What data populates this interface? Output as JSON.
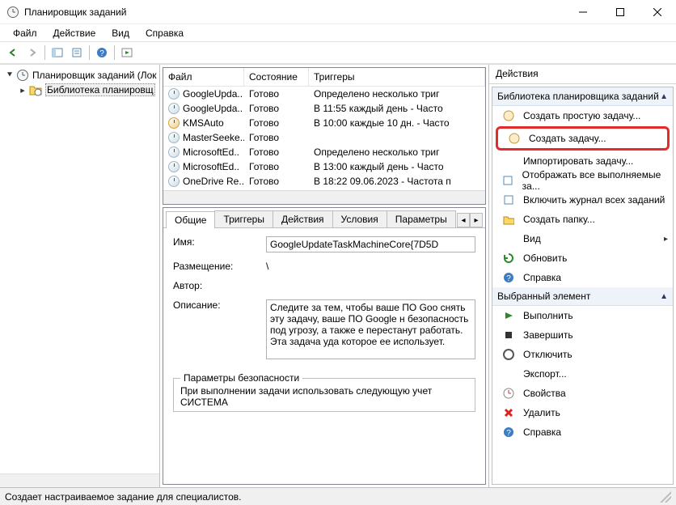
{
  "window": {
    "title": "Планировщик заданий"
  },
  "menubar": {
    "file": "Файл",
    "action": "Действие",
    "view": "Вид",
    "help": "Справка"
  },
  "tree": {
    "root": "Планировщик заданий (Лок",
    "child": "Библиотека планировщ"
  },
  "list": {
    "columns": {
      "file": "Файл",
      "state": "Состояние",
      "trigger": "Триггеры"
    },
    "rows": [
      {
        "name": "GoogleUpda..",
        "state": "Готово",
        "trigger": "Определено несколько триг"
      },
      {
        "name": "GoogleUpda..",
        "state": "Готово",
        "trigger": "В 11:55 каждый день - Часто"
      },
      {
        "name": "KMSAuto",
        "state": "Готово",
        "trigger": "В 10:00 каждые 10 дн. - Часто"
      },
      {
        "name": "MasterSeeke..",
        "state": "Готово",
        "trigger": ""
      },
      {
        "name": "MicrosoftEd..",
        "state": "Готово",
        "trigger": "Определено несколько триг"
      },
      {
        "name": "MicrosoftEd..",
        "state": "Готово",
        "trigger": "В 13:00 каждый день - Часто"
      },
      {
        "name": "OneDrive Re..",
        "state": "Готово",
        "trigger": "В 18:22 09.06.2023 - Частота п"
      }
    ]
  },
  "detail": {
    "tabs": {
      "general": "Общие",
      "triggers": "Триггеры",
      "actions": "Действия",
      "conditions": "Условия",
      "settings": "Параметры"
    },
    "labels": {
      "name": "Имя:",
      "location": "Размещение:",
      "author": "Автор:",
      "description": "Описание:"
    },
    "values": {
      "name": "GoogleUpdateTaskMachineCore{7D5D",
      "location": "\\",
      "author": "",
      "description": "Следите за тем, чтобы ваше ПО Goo снять эту задачу, ваше ПО Google н безопасность под угрозу, а также е перестанут работать. Эта задача уда которое ее использует."
    },
    "security": {
      "legend": "Параметры безопасности",
      "line1": "При выполнении задачи использовать следующую учет",
      "account": "СИСТЕМА"
    }
  },
  "actions": {
    "title": "Действия",
    "section1": "Библиотека планировщика заданий",
    "items1": [
      "Создать простую задачу...",
      "Создать задачу...",
      "Импортировать задачу...",
      "Отображать все выполняемые за...",
      "Включить журнал всех заданий",
      "Создать папку...",
      "Вид",
      "Обновить",
      "Справка"
    ],
    "section2": "Выбранный элемент",
    "items2": [
      "Выполнить",
      "Завершить",
      "Отключить",
      "Экспорт...",
      "Свойства",
      "Удалить",
      "Справка"
    ]
  },
  "statusbar": {
    "text": "Создает настраиваемое задание для специалистов."
  }
}
